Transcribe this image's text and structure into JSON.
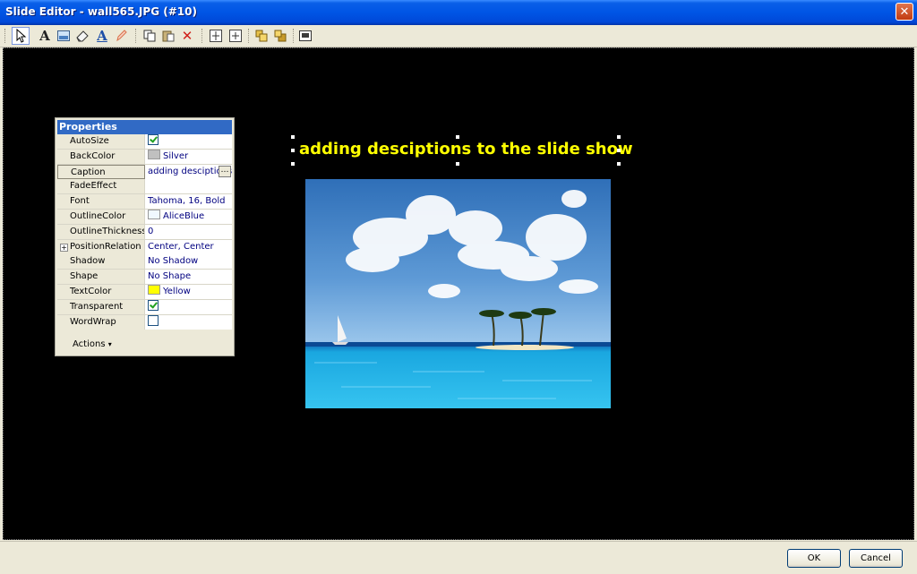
{
  "window": {
    "title": "Slide Editor - wall565.JPG (#10)",
    "close_symbol": "✕"
  },
  "toolbar": {
    "buttons": [
      {
        "icon": "pointer-icon"
      },
      {
        "icon": "text-tool-icon",
        "glyph": "A"
      },
      {
        "icon": "image-tool-icon"
      },
      {
        "icon": "eraser-icon"
      },
      {
        "icon": "font-color-icon",
        "glyph": "A"
      },
      {
        "icon": "pencil-icon"
      },
      {
        "icon": "copy-icon"
      },
      {
        "icon": "paste-icon"
      },
      {
        "icon": "delete-icon",
        "glyph": "✕"
      },
      {
        "icon": "center-horizontal-icon"
      },
      {
        "icon": "center-vertical-icon"
      },
      {
        "icon": "bring-to-front-icon"
      },
      {
        "icon": "send-to-back-icon"
      },
      {
        "icon": "fit-to-slide-icon"
      }
    ]
  },
  "slide": {
    "caption": "adding desciptions to the slide show",
    "caption_color": "#ffff00",
    "background_color": "#000000"
  },
  "properties": {
    "header": "Properties",
    "rows": [
      {
        "name": "AutoSize",
        "type": "check",
        "checked": true
      },
      {
        "name": "BackColor",
        "type": "color",
        "swatch": "#c0c0c0",
        "value": "Silver"
      },
      {
        "name": "Caption",
        "type": "text",
        "value": "adding desciptions",
        "selected": true
      },
      {
        "name": "FadeEffect",
        "type": "text",
        "value": ""
      },
      {
        "name": "Font",
        "type": "text",
        "value": "Tahoma, 16, Bold"
      },
      {
        "name": "OutlineColor",
        "type": "color",
        "swatch": "#f0f8ff",
        "value": "AliceBlue"
      },
      {
        "name": "OutlineThickness",
        "type": "text",
        "value": "0"
      },
      {
        "name": "PositionRelation",
        "type": "text",
        "value": "Center, Center",
        "expandable": true
      },
      {
        "name": "Shadow",
        "type": "text",
        "value": "No Shadow"
      },
      {
        "name": "Shape",
        "type": "text",
        "value": "No Shape"
      },
      {
        "name": "TextColor",
        "type": "color",
        "swatch": "#ffff00",
        "value": "Yellow"
      },
      {
        "name": "Transparent",
        "type": "check",
        "checked": true
      },
      {
        "name": "WordWrap",
        "type": "check",
        "checked": false
      }
    ],
    "actions_label": "Actions",
    "actions_arrow": "▾",
    "ellipsis": "…",
    "expand_symbol": "+"
  },
  "dialog": {
    "ok_label": "OK",
    "cancel_label": "Cancel"
  }
}
